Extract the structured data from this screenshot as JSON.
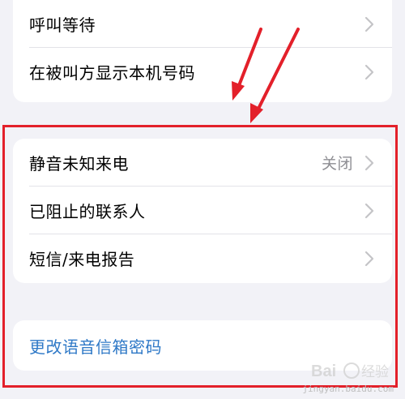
{
  "settings": {
    "top_group": {
      "items": [
        {
          "label": "呼叫等待"
        },
        {
          "label": "在被叫方显示本机号码"
        }
      ]
    },
    "middle_group": {
      "items": [
        {
          "label": "静音未知来电",
          "value": "关闭"
        },
        {
          "label": "已阻止的联系人"
        },
        {
          "label": "短信/来电报告"
        }
      ]
    },
    "bottom_group": {
      "link_label": "更改语音信箱密码"
    }
  },
  "annotation": {
    "frame_color": "#e3202a",
    "arrow_color": "#e3202a"
  },
  "watermark": {
    "text": "jingyan.baidu.com"
  },
  "colors": {
    "background": "#f2f2f7",
    "link": "#2f79c7",
    "secondary_text": "#8e8e93",
    "chevron": "#c4c4c7"
  }
}
